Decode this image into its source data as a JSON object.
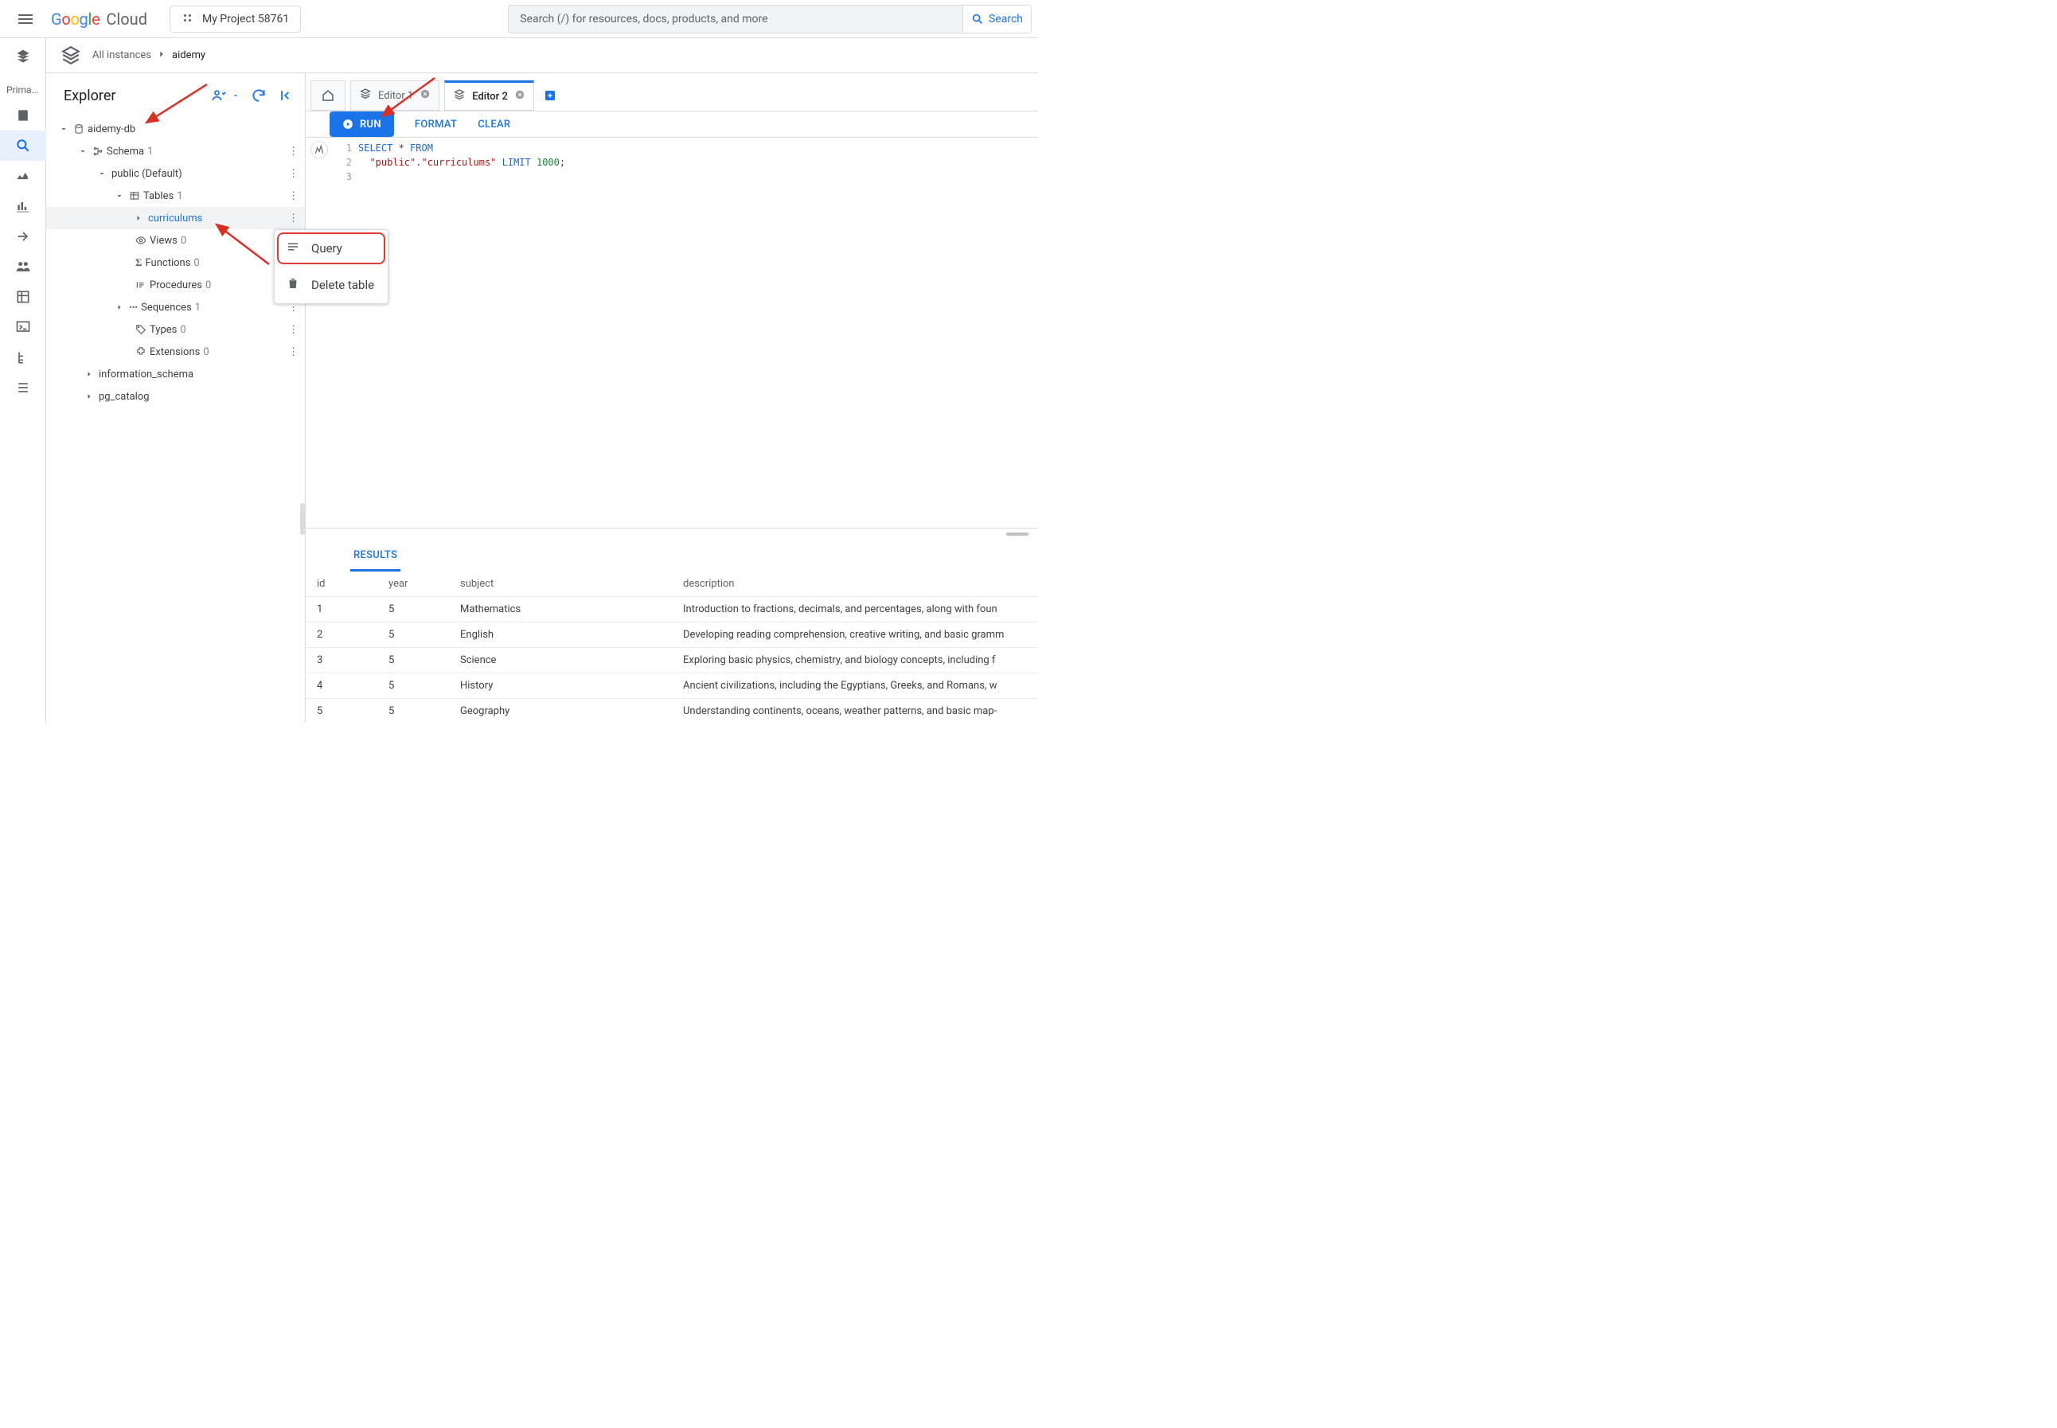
{
  "header": {
    "logo_cloud": "Cloud",
    "project": "My Project 58761",
    "search_placeholder": "Search (/) for resources, docs, products, and more",
    "search_button": "Search"
  },
  "rail": {
    "label": "Prima..."
  },
  "breadcrumb": {
    "root": "All instances",
    "current": "aidemy"
  },
  "explorer": {
    "title": "Explorer",
    "db": "aidemy-db",
    "schema": {
      "label": "Schema",
      "count": "1"
    },
    "public": "public (Default)",
    "tables": {
      "label": "Tables",
      "count": "1"
    },
    "curriculums": "curriculums",
    "views": {
      "label": "Views",
      "count": "0"
    },
    "functions": {
      "label": "Functions",
      "count": "0"
    },
    "procedures": {
      "label": "Procedures",
      "count": "0"
    },
    "sequences": {
      "label": "Sequences",
      "count": "1"
    },
    "types": {
      "label": "Types",
      "count": "0"
    },
    "extensions": {
      "label": "Extensions",
      "count": "0"
    },
    "info_schema": "information_schema",
    "pg_catalog": "pg_catalog"
  },
  "context_menu": {
    "query": "Query",
    "delete": "Delete table"
  },
  "tabs": {
    "editor1": "Editor 1",
    "editor2": "Editor 2"
  },
  "toolbar": {
    "run": "RUN",
    "format": "FORMAT",
    "clear": "CLEAR"
  },
  "sql": {
    "l1_select": "SELECT",
    "l1_star": " * ",
    "l1_from": "FROM",
    "l2_pre": "  ",
    "l2_s1": "\"public\"",
    "l2_dot": ".",
    "l2_s2": "\"curriculums\"",
    "l2_limit": " LIMIT ",
    "l2_num": "1000",
    "l2_semi": ";"
  },
  "results": {
    "tab": "RESULTS",
    "cols": [
      "id",
      "year",
      "subject",
      "description"
    ],
    "rows": [
      [
        "1",
        "5",
        "Mathematics",
        "Introduction to fractions, decimals, and percentages, along with foun"
      ],
      [
        "2",
        "5",
        "English",
        "Developing reading comprehension, creative writing, and basic gramm"
      ],
      [
        "3",
        "5",
        "Science",
        "Exploring basic physics, chemistry, and biology concepts, including f"
      ],
      [
        "4",
        "5",
        "History",
        "Ancient civilizations, including the Egyptians, Greeks, and Romans, w"
      ],
      [
        "5",
        "5",
        "Geography",
        "Understanding continents, oceans, weather patterns, and basic map-"
      ]
    ]
  }
}
